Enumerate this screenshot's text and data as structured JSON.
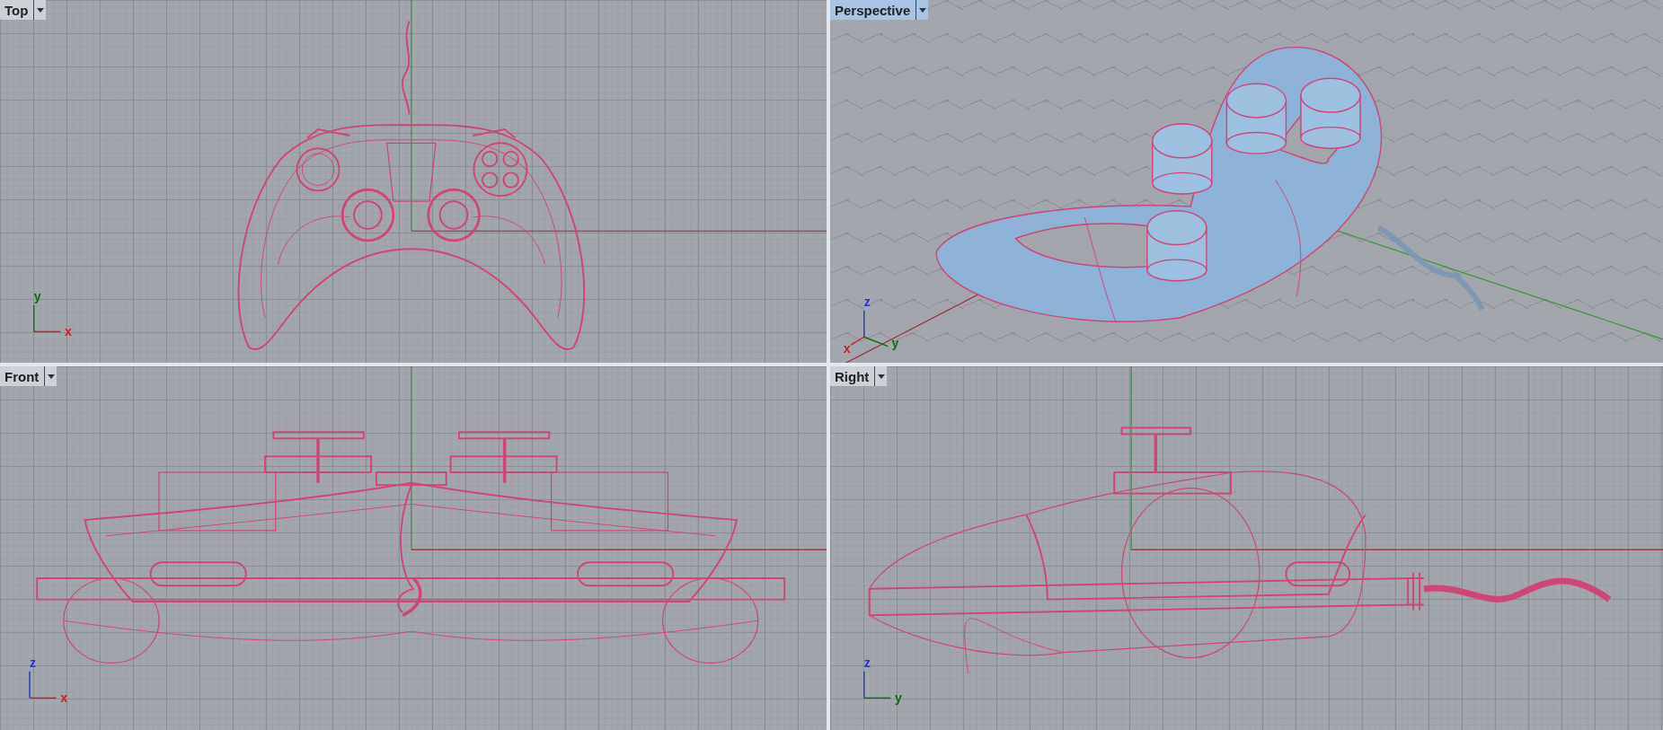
{
  "viewports": [
    {
      "title": "Top",
      "kind": "top",
      "selected": false,
      "axis_labels": [
        "x",
        "y"
      ]
    },
    {
      "title": "Perspective",
      "kind": "perspective",
      "selected": true,
      "axis_labels": [
        "x",
        "y",
        "z"
      ]
    },
    {
      "title": "Front",
      "kind": "front",
      "selected": false,
      "axis_labels": [
        "x",
        "z"
      ]
    },
    {
      "title": "Right",
      "kind": "right",
      "selected": false,
      "axis_labels": [
        "y",
        "z"
      ]
    }
  ]
}
